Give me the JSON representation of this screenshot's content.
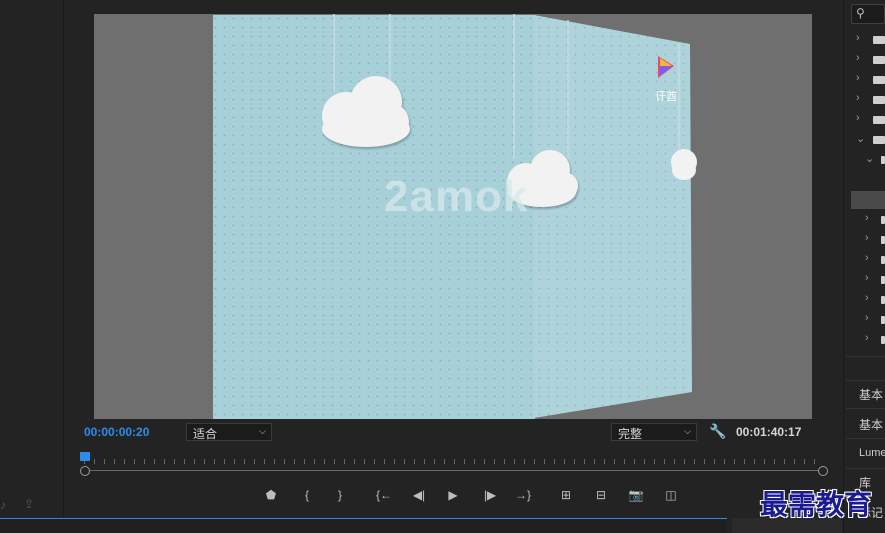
{
  "monitor": {
    "current_timecode": "00:00:00:20",
    "zoom_select": "适合",
    "quality_select": "完整",
    "total_duration": "00:01:40:17"
  },
  "video_frame": {
    "watermark_text": "2amok",
    "logo_text": "讦酋"
  },
  "transport": [
    {
      "name": "add-marker-button",
      "glyph": "⬟"
    },
    {
      "name": "mark-in-button",
      "glyph": "{"
    },
    {
      "name": "mark-out-button",
      "glyph": "}"
    },
    {
      "name": "go-to-in-button",
      "glyph": "{←"
    },
    {
      "name": "step-back-button",
      "glyph": "◀|"
    },
    {
      "name": "play-button",
      "glyph": "▶"
    },
    {
      "name": "step-forward-button",
      "glyph": "|▶"
    },
    {
      "name": "go-to-out-button",
      "glyph": "→}"
    },
    {
      "name": "lift-button",
      "glyph": "⊞"
    },
    {
      "name": "extract-button",
      "glyph": "⊟"
    },
    {
      "name": "export-frame-button",
      "glyph": "📷"
    },
    {
      "name": "compare-view-button",
      "glyph": "◫"
    }
  ],
  "right_panel": {
    "labels": [
      "基本",
      "基本",
      "Lume",
      "库",
      "标记"
    ]
  },
  "overlay_watermark": "最需教育",
  "colors": {
    "accent": "#2d8ceb",
    "background": "#232323",
    "frame_blue": "#a8d0d8"
  }
}
